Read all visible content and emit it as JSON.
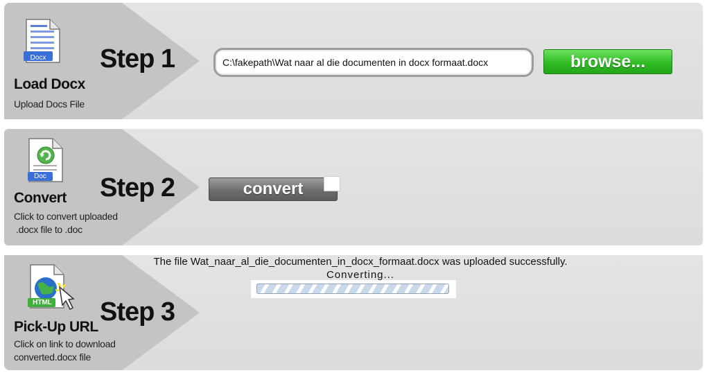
{
  "steps": [
    {
      "step_label": "Step 1",
      "title": "Load Docx",
      "description": "Upload Docs File",
      "icon_badge": "Docx",
      "icon": "docx-file-icon"
    },
    {
      "step_label": "Step 2",
      "title": "Convert",
      "description_line1": "Click to convert uploaded",
      "description_line2": ".docx file to .doc",
      "icon_badge": "Doc",
      "icon": "doc-convert-file-icon"
    },
    {
      "step_label": "Step 3",
      "title": "Pick-Up URL",
      "description_line1": "Click on link to download",
      "description_line2": "converted.docx file",
      "icon_badge": "HTML",
      "icon": "html-globe-file-icon"
    }
  ],
  "upload": {
    "file_path": "C:\\fakepath\\Wat naar al die documenten in docx formaat.docx",
    "browse_label": "browse..."
  },
  "convert": {
    "button_label": "convert"
  },
  "status": {
    "upload_message": "The file Wat_naar_al_die_documenten_in_docx_formaat.docx was uploaded successfully.",
    "converting_message": "Converting..."
  },
  "colors": {
    "browse_green": "#2fbc24",
    "convert_gray": "#6d6d6d",
    "panel_bg": "#dcdcdc"
  }
}
